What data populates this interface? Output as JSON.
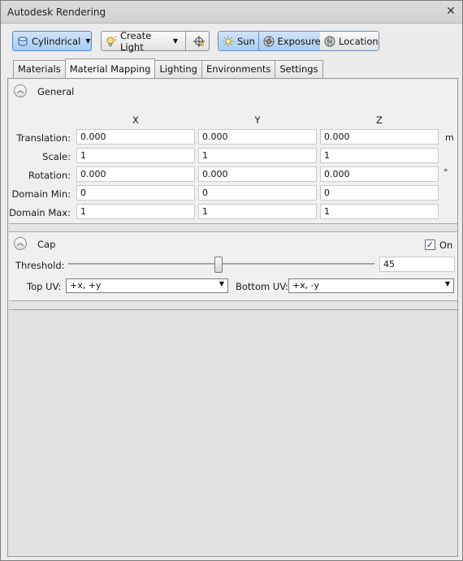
{
  "window": {
    "title": "Autodesk Rendering",
    "close_glyph": "✕"
  },
  "toolbar": {
    "mapping_type": "Cylindrical",
    "create_light": "Create Light",
    "sun": "Sun",
    "exposure": "Exposure",
    "location": "Location"
  },
  "tabs": [
    "Materials",
    "Material Mapping",
    "Lighting",
    "Environments",
    "Settings"
  ],
  "general": {
    "title": "General",
    "columns": [
      "X",
      "Y",
      "Z"
    ],
    "rows": [
      {
        "label": "Translation:",
        "values": [
          "0.000",
          "0.000",
          "0.000"
        ],
        "unit": "m"
      },
      {
        "label": "Scale:",
        "values": [
          "1",
          "1",
          "1"
        ],
        "unit": ""
      },
      {
        "label": "Rotation:",
        "values": [
          "0.000",
          "0.000",
          "0.000"
        ],
        "unit": "°"
      },
      {
        "label": "Domain Min:",
        "values": [
          "0",
          "0",
          "0"
        ],
        "unit": ""
      },
      {
        "label": "Domain Max:",
        "values": [
          "1",
          "1",
          "1"
        ],
        "unit": ""
      }
    ]
  },
  "cap": {
    "title": "Cap",
    "on_label": "On",
    "on_checked": true,
    "threshold_label": "Threshold:",
    "threshold_value": "45",
    "threshold_level_percent": 49,
    "top_uv_label": "Top UV:",
    "top_uv_value": "+x, +y",
    "bottom_uv_label": "Bottom UV:",
    "bottom_uv_value": "+x, -y"
  },
  "icons": {
    "cylinder": "cylinder-icon",
    "bulb": "light-bulb-icon",
    "target": "target-icon",
    "sun": "sun-icon",
    "exposure": "exposure-icon",
    "globe": "globe-icon"
  }
}
